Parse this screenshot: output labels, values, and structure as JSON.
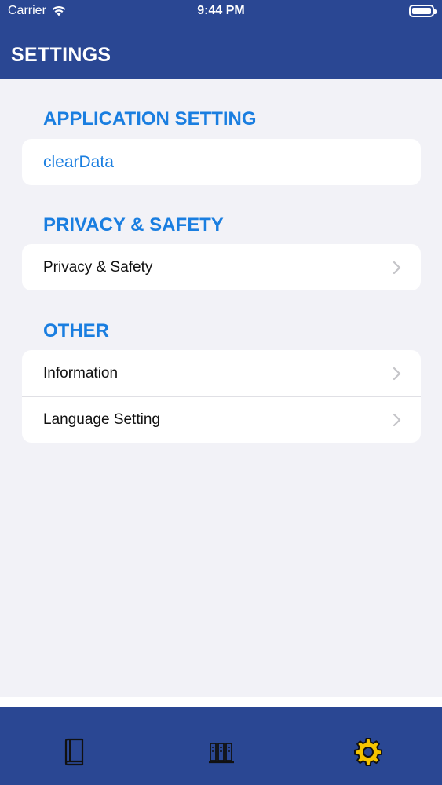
{
  "status_bar": {
    "carrier": "Carrier",
    "time": "9:44 PM"
  },
  "header": {
    "title": "SETTINGS"
  },
  "sections": [
    {
      "title": "APPLICATION SETTING",
      "items": [
        {
          "label": "clearData"
        }
      ]
    },
    {
      "title": "PRIVACY & SAFETY",
      "items": [
        {
          "label": "Privacy & Safety"
        }
      ]
    },
    {
      "title": "OTHER",
      "items": [
        {
          "label": "Information"
        },
        {
          "label": "Language Setting"
        }
      ]
    }
  ],
  "tabs": [
    {
      "icon": "book-icon"
    },
    {
      "icon": "bookshelf-icon"
    },
    {
      "icon": "gear-icon"
    }
  ],
  "colors": {
    "header_bg": "#2a4793",
    "accent": "#1a7ee0",
    "active_tab": "#f5c400",
    "background": "#f2f2f7"
  }
}
